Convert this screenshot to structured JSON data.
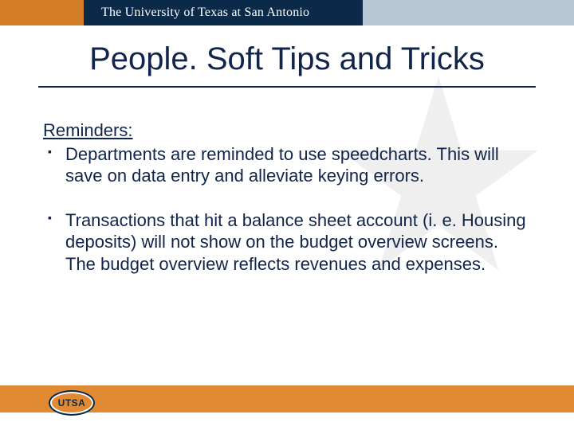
{
  "header": {
    "org_name": "The University of Texas at San Antonio"
  },
  "title": "People. Soft Tips and Tricks",
  "section_heading": "Reminders:",
  "bullets": [
    "Departments are reminded to use speedcharts. This will save on data entry and alleviate keying errors.",
    "Transactions that hit a balance sheet account (i. e. Housing deposits) will not show on the budget overview screens. The budget overview reflects revenues and expenses."
  ],
  "footer": {
    "logo_text": "UTSA"
  }
}
